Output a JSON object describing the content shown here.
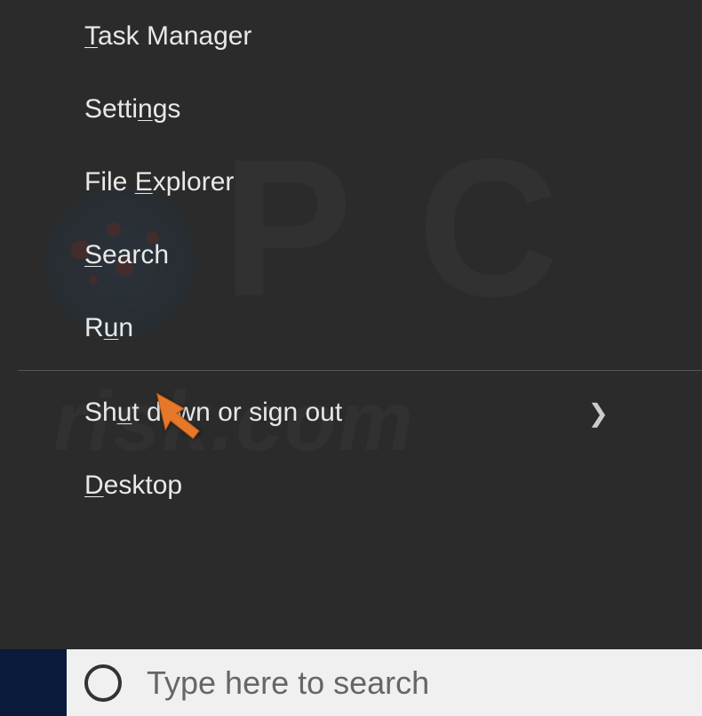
{
  "menu": {
    "items": [
      {
        "pre": "",
        "acc": "T",
        "post": "ask Manager",
        "hasSubmenu": false
      },
      {
        "pre": "Setti",
        "acc": "n",
        "post": "gs",
        "hasSubmenu": false
      },
      {
        "pre": "File ",
        "acc": "E",
        "post": "xplorer",
        "hasSubmenu": false
      },
      {
        "pre": "",
        "acc": "S",
        "post": "earch",
        "hasSubmenu": false
      },
      {
        "pre": "R",
        "acc": "u",
        "post": "n",
        "hasSubmenu": false
      },
      {
        "pre": "Sh",
        "acc": "u",
        "post": "t down or sign out",
        "hasSubmenu": true
      },
      {
        "pre": "",
        "acc": "D",
        "post": "esktop",
        "hasSubmenu": false
      }
    ]
  },
  "search": {
    "placeholder": "Type here to search"
  },
  "watermark": {
    "text": "risk.com"
  }
}
